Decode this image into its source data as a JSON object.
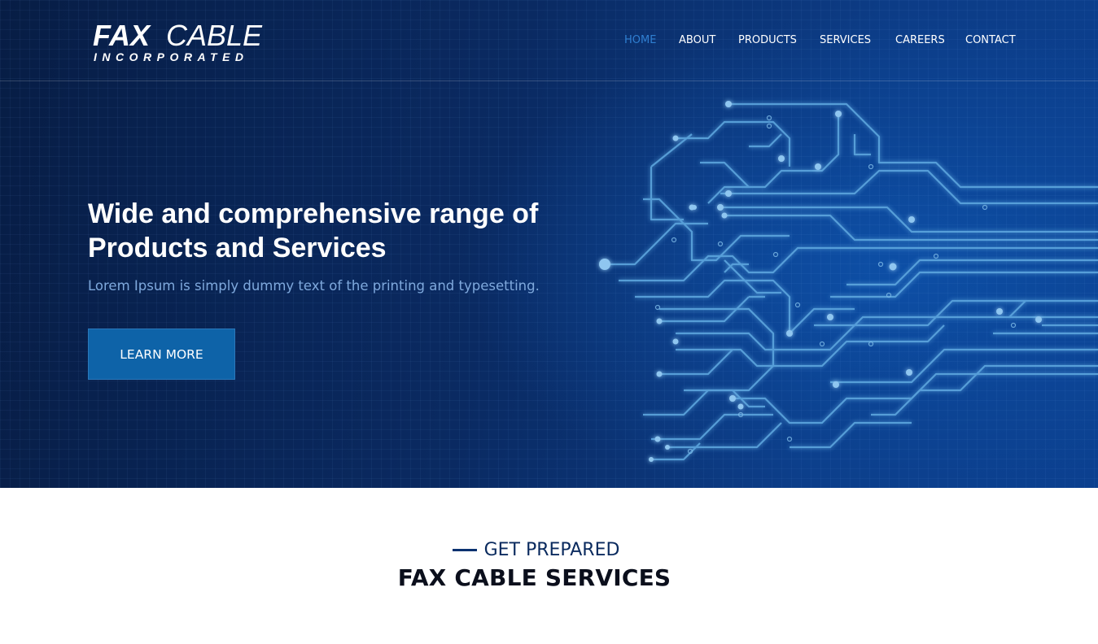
{
  "header": {
    "logo": {
      "line1_a": "FAX",
      "line1_b": "CABLE",
      "line2": "INCORPORATED"
    },
    "nav": [
      {
        "label": "HOME",
        "active": true
      },
      {
        "label": "ABOUT",
        "active": false
      },
      {
        "label": "PRODUCTS",
        "active": false
      },
      {
        "label": "SERVICES",
        "active": false
      },
      {
        "label": "CAREERS",
        "active": false
      },
      {
        "label": "CONTACT",
        "active": false
      }
    ]
  },
  "hero": {
    "title_line1": "Wide and comprehensive range of",
    "title_line2": "Products and Services",
    "subtitle": "Lorem Ipsum is simply dummy text of the printing and typesetting.",
    "button_label": "LEARN MORE",
    "illustration": "circuit-board-icon"
  },
  "section": {
    "eyebrow": "GET PREPARED",
    "title": "FAX CABLE SERVICES"
  },
  "colors": {
    "nav_active": "#2f7fd1",
    "button": "#0e63a8",
    "hero_dark": "#071d45",
    "hero_light": "#0c3c86",
    "subtitle": "#7fa9dd",
    "eyebrow": "#0a2a5e"
  }
}
